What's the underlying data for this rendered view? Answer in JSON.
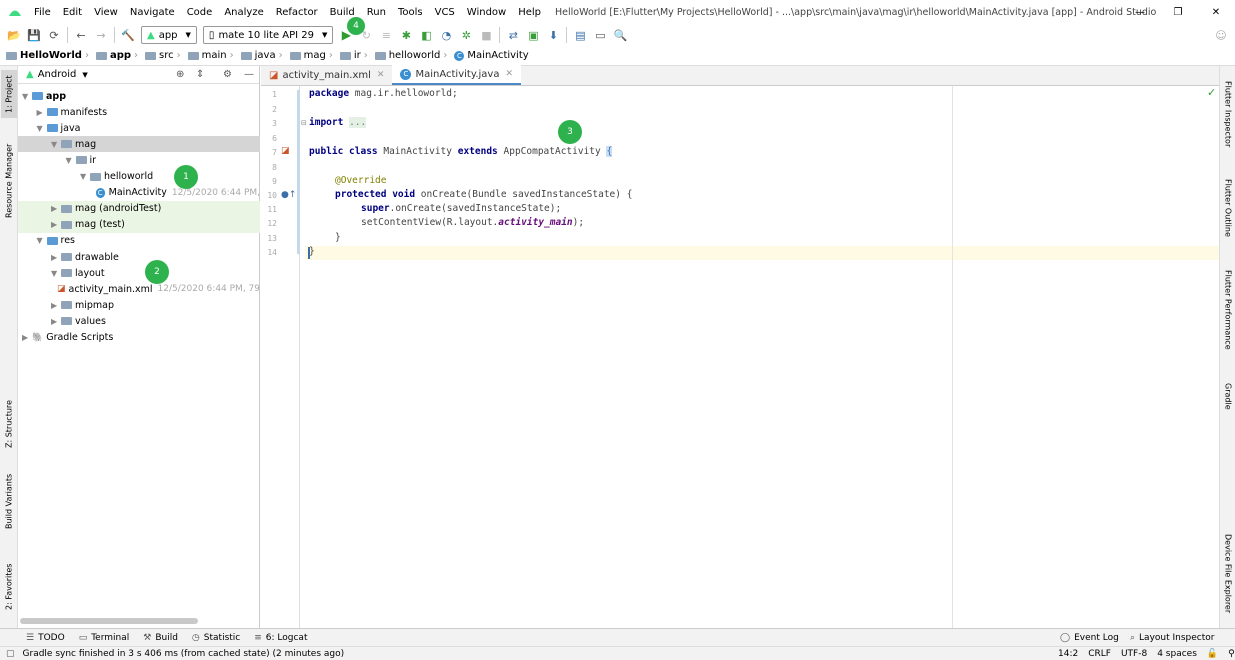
{
  "menu": {
    "items": [
      "File",
      "Edit",
      "View",
      "Navigate",
      "Code",
      "Analyze",
      "Refactor",
      "Build",
      "Run",
      "Tools",
      "VCS",
      "Window",
      "Help"
    ],
    "underline": [
      "F",
      "E",
      "V",
      "N",
      "C",
      "z",
      "R",
      "B",
      "u",
      "T",
      "S",
      "W",
      "H"
    ],
    "title": "HelloWorld [E:\\Flutter\\My Projects\\HelloWorld] - ...\\app\\src\\main\\java\\mag\\ir\\helloworld\\MainActivity.java [app] - Android Studio"
  },
  "toolbar": {
    "config": "app",
    "device": "mate 10 lite API 29"
  },
  "breadcrumb": [
    "HelloWorld",
    "app",
    "src",
    "main",
    "java",
    "mag",
    "ir",
    "helloworld",
    "MainActivity"
  ],
  "project": {
    "view": "Android",
    "tree": [
      {
        "label": "app",
        "depth": 0,
        "arrow": "▼",
        "icon": "folder",
        "bold": true
      },
      {
        "label": "manifests",
        "depth": 1,
        "arrow": "▶",
        "icon": "folder"
      },
      {
        "label": "java",
        "depth": 1,
        "arrow": "▼",
        "icon": "folder"
      },
      {
        "label": "mag",
        "depth": 2,
        "arrow": "▼",
        "icon": "package",
        "sel": true
      },
      {
        "label": "ir",
        "depth": 3,
        "arrow": "▼",
        "icon": "package"
      },
      {
        "label": "helloworld",
        "depth": 4,
        "arrow": "▼",
        "icon": "package"
      },
      {
        "label": "MainActivity",
        "depth": 5,
        "arrow": "",
        "icon": "class",
        "meta": "12/5/2020 6:44 PM,"
      },
      {
        "label": "mag (androidTest)",
        "depth": 2,
        "arrow": "▶",
        "icon": "package",
        "green": true
      },
      {
        "label": "mag (test)",
        "depth": 2,
        "arrow": "▶",
        "icon": "package",
        "green": true
      },
      {
        "label": "res",
        "depth": 1,
        "arrow": "▼",
        "icon": "folder"
      },
      {
        "label": "drawable",
        "depth": 2,
        "arrow": "▶",
        "icon": "folder"
      },
      {
        "label": "layout",
        "depth": 2,
        "arrow": "▼",
        "icon": "folder"
      },
      {
        "label": "activity_main.xml",
        "depth": 3,
        "arrow": "",
        "icon": "xml",
        "meta": "12/5/2020 6:44 PM, 79"
      },
      {
        "label": "mipmap",
        "depth": 2,
        "arrow": "▶",
        "icon": "folder"
      },
      {
        "label": "values",
        "depth": 2,
        "arrow": "▶",
        "icon": "folder"
      },
      {
        "label": "Gradle Scripts",
        "depth": 0,
        "arrow": "▶",
        "icon": "gradle"
      }
    ]
  },
  "badges": [
    "1",
    "2",
    "3",
    "4"
  ],
  "tabs": [
    {
      "label": "activity_main.xml",
      "active": false
    },
    {
      "label": "MainActivity.java",
      "active": true
    }
  ],
  "code": {
    "line_numbers": [
      "1",
      "2",
      "3",
      "6",
      "7",
      "8",
      "9",
      "10",
      "11",
      "12",
      "13",
      "14"
    ],
    "package_name": "mag.ir.helloworld;",
    "import_fold": "...",
    "class_name": "MainActivity",
    "super_class": "AppCompatActivity",
    "annotation": "@Override",
    "method_sig": " onCreate(Bundle savedInstanceState) {",
    "super_call": ".onCreate(savedInstanceState);",
    "set_content": "setContentView(R.layout.",
    "layout_field": "activity_main",
    "close_paren": ");",
    "close_brace": "}",
    "last_brace": "}"
  },
  "left_tabs": [
    "1: Project",
    "Resource Manager",
    "Z: Structure",
    "Build Variants",
    "2: Favorites"
  ],
  "right_tabs": [
    "Flutter Inspector",
    "Flutter Outline",
    "Flutter Performance",
    "Gradle",
    "Device File Explorer"
  ],
  "tool_windows": [
    "TODO",
    "Terminal",
    "Build",
    "Statistic",
    "6: Logcat"
  ],
  "tool_windows_right": [
    "Event Log",
    "Layout Inspector"
  ],
  "status": {
    "message": "Gradle sync finished in 3 s 406 ms (from cached state) (2 minutes ago)",
    "position": "14:2",
    "line_sep": "CRLF",
    "encoding": "UTF-8",
    "indent": "4 spaces"
  },
  "colors": {
    "badge": "#2eb24e",
    "accent": "#4a88c7"
  }
}
